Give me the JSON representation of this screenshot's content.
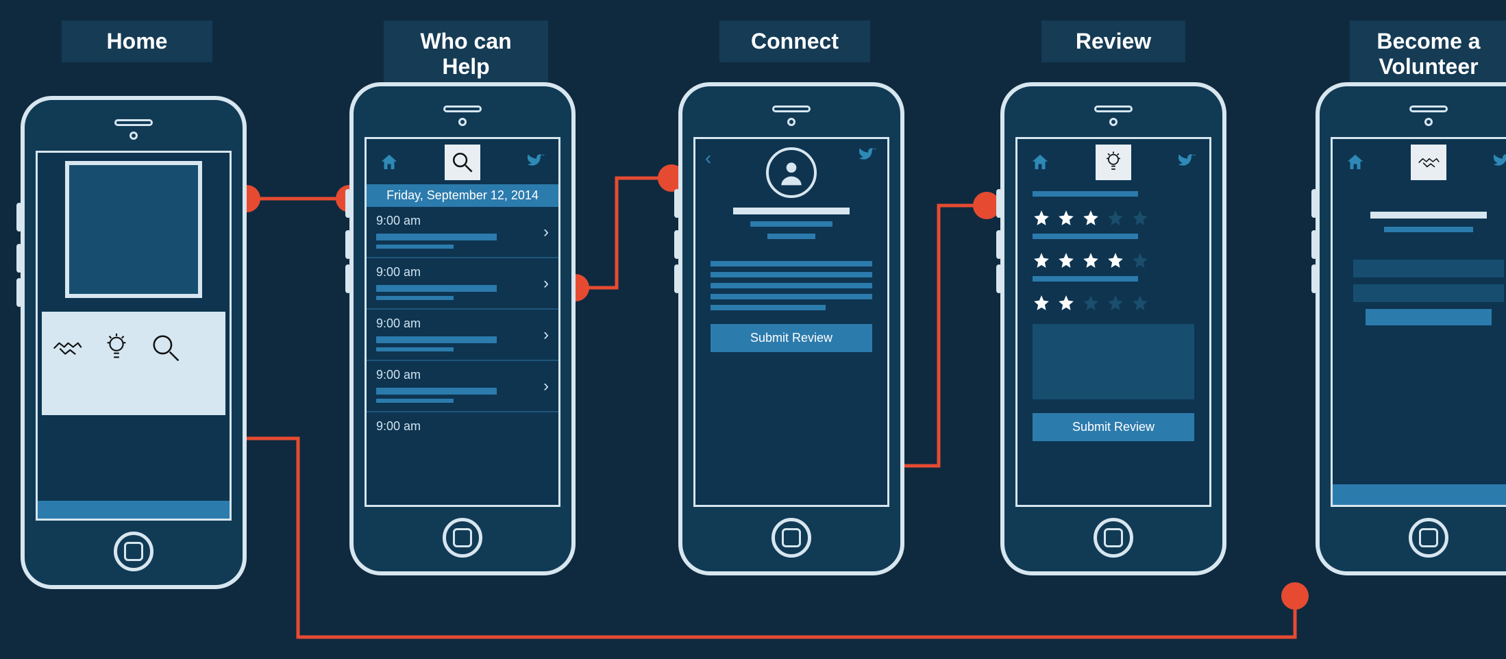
{
  "labels": {
    "home": "Home",
    "help": "Who can Help",
    "connect": "Connect",
    "review": "Review",
    "volunteer": "Become a Volunteer"
  },
  "help_screen": {
    "date": "Friday, September 12, 2014",
    "slots": [
      "9:00 am",
      "9:00 am",
      "9:00 am",
      "9:00 am",
      "9:00 am"
    ]
  },
  "connect_screen": {
    "submit": "Submit Review"
  },
  "review_screen": {
    "submit": "Submit Review",
    "ratings": [
      3,
      4,
      2
    ]
  }
}
